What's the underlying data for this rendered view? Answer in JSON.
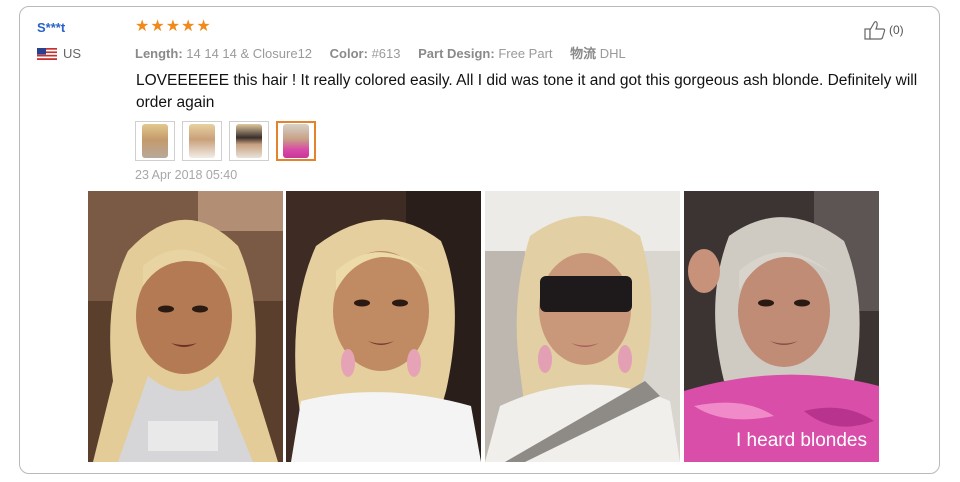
{
  "review": {
    "username": "S***t",
    "country": "US",
    "rating": 5,
    "likes": "(0)",
    "properties": [
      {
        "label": "Length:",
        "value": "14 14 14 & Closure12"
      },
      {
        "label": "Color:",
        "value": "#613"
      },
      {
        "label": "Part Design:",
        "value": "Free Part"
      },
      {
        "label": "物流",
        "value": "DHL"
      }
    ],
    "text": "LOVEEEEEE this hair ! It really colored easily. All I did was tone it and got this gorgeous ash blonde. Definitely will order again",
    "date": "23 Apr 2018 05:40",
    "photo_caption": "I heard blondes"
  },
  "colors": {
    "username": "#2b62c6",
    "stars": "#f08a1a",
    "selected_thumb_border": "#e4832b"
  },
  "icons": {
    "star": "star-icon",
    "like": "thumbs-up-icon",
    "flag": "us-flag-icon"
  }
}
